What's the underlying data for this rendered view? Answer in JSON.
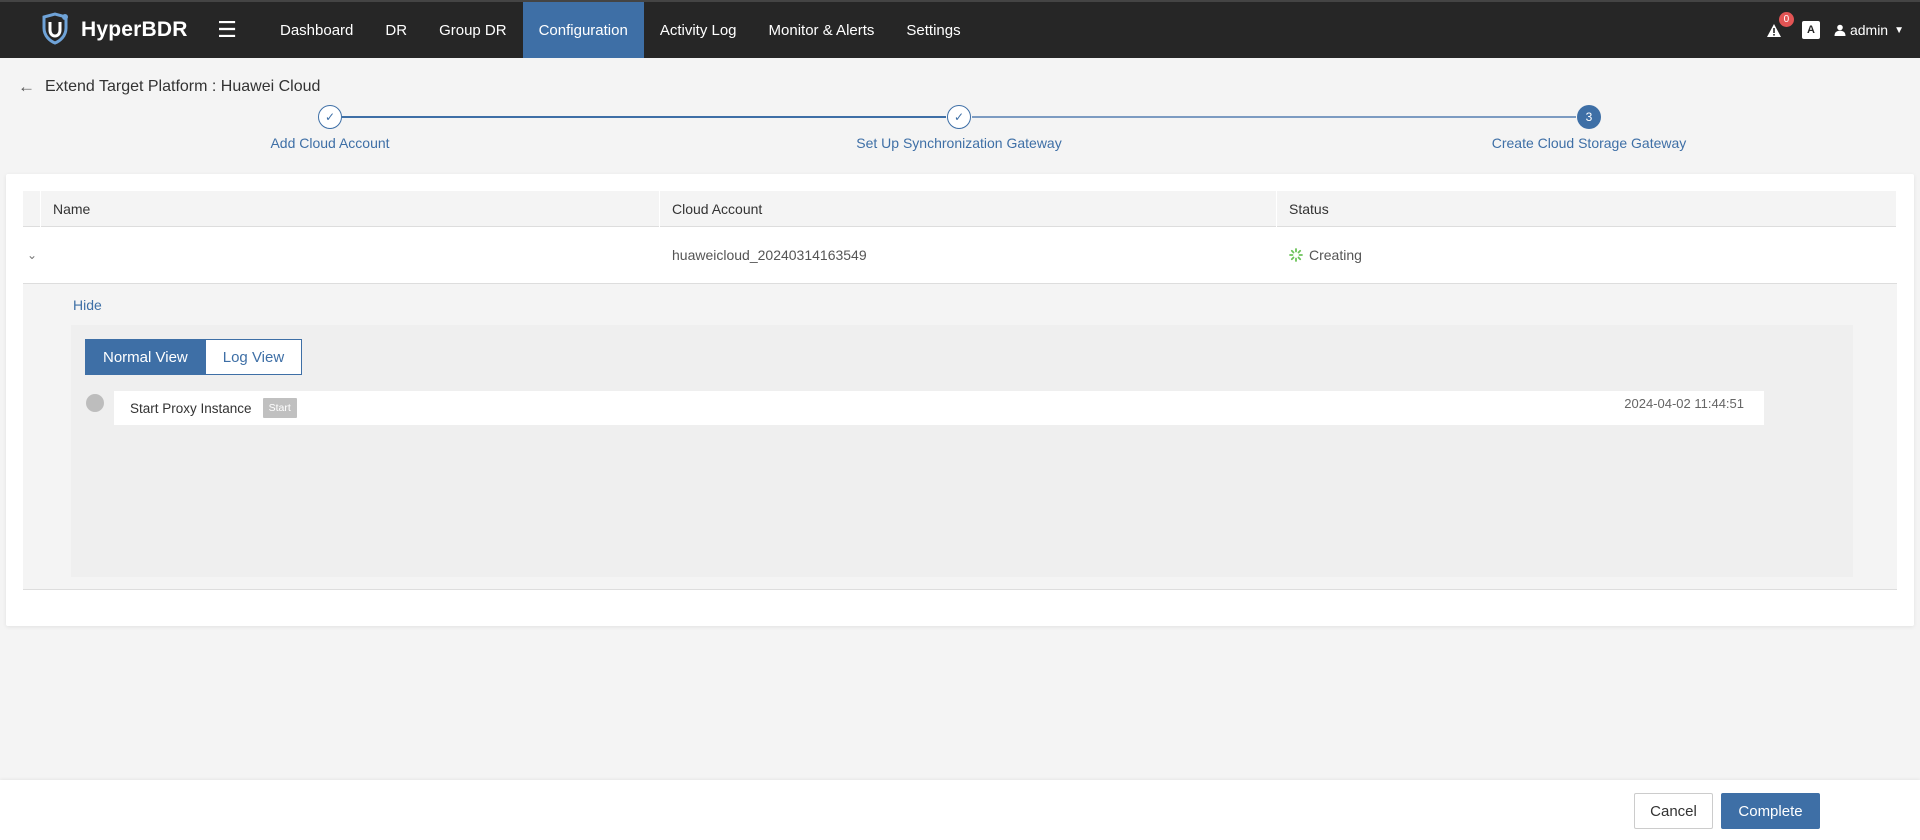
{
  "app": {
    "brand": "HyperBDR"
  },
  "nav": {
    "items": [
      {
        "label": "Dashboard"
      },
      {
        "label": "DR"
      },
      {
        "label": "Group DR"
      },
      {
        "label": "Configuration",
        "active": true
      },
      {
        "label": "Activity Log"
      },
      {
        "label": "Monitor & Alerts"
      },
      {
        "label": "Settings"
      }
    ],
    "alerts_count": "0",
    "font_icon": "A",
    "user": "admin"
  },
  "page": {
    "title": "Extend Target Platform : Huawei Cloud"
  },
  "steps": [
    {
      "label": "Add Cloud Account",
      "state": "done"
    },
    {
      "label": "Set Up Synchronization Gateway",
      "state": "done"
    },
    {
      "number": "3",
      "label": "Create Cloud Storage Gateway",
      "state": "current"
    }
  ],
  "table": {
    "columns": [
      "Name",
      "Cloud Account",
      "Status"
    ],
    "row": {
      "name": "",
      "cloud_account": "huaweicloud_20240314163549",
      "status": "Creating"
    }
  },
  "detail": {
    "hide_label": "Hide",
    "views": [
      "Normal View",
      "Log View"
    ],
    "timeline": [
      {
        "name": "Start Proxy Instance",
        "badge": "Start",
        "time": "2024-04-02 11:44:51"
      }
    ]
  },
  "footer": {
    "cancel": "Cancel",
    "complete": "Complete"
  },
  "colors": {
    "primary": "#3e6fa6",
    "navbar": "#262626",
    "success": "#6cc35a",
    "alert": "#e25454"
  }
}
